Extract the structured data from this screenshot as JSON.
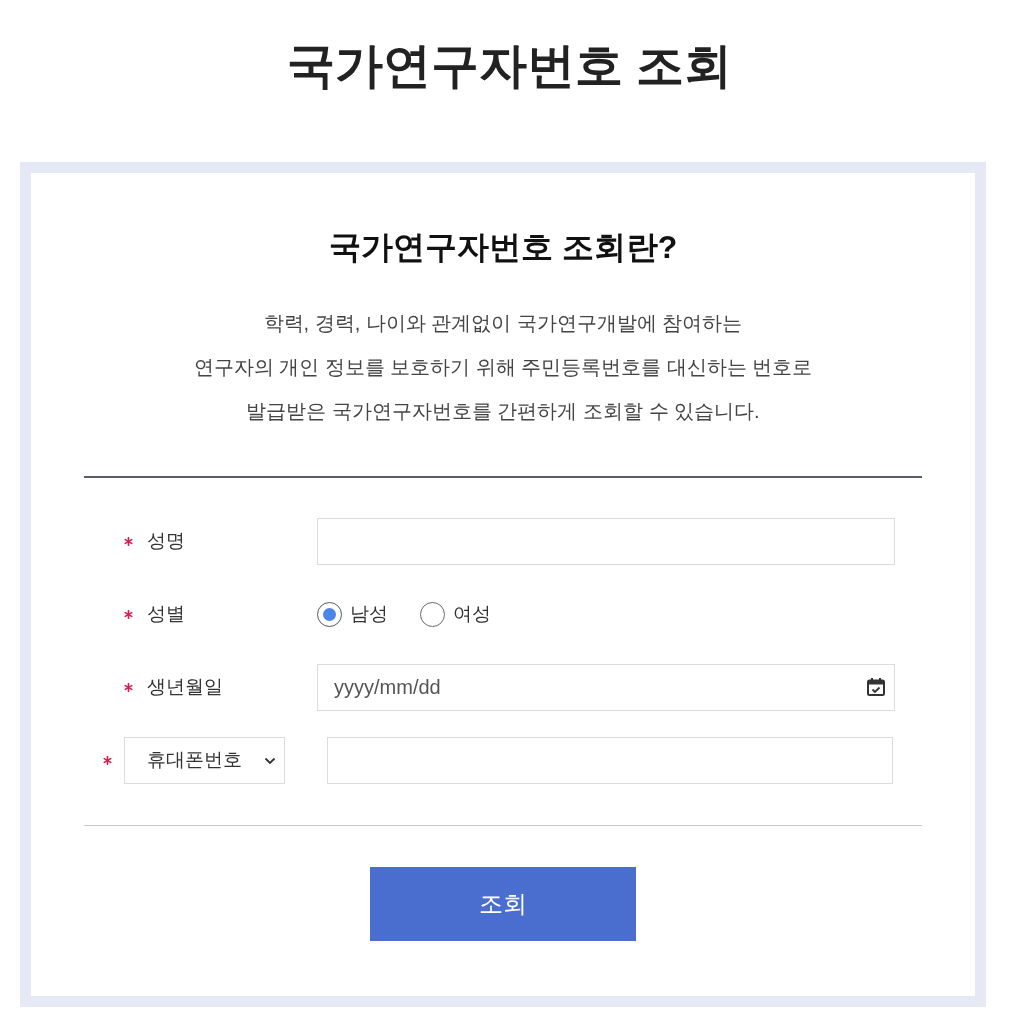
{
  "page": {
    "title": "국가연구자번호 조회"
  },
  "info": {
    "heading": "국가연구자번호 조회란?",
    "lines": [
      "학력, 경력, 나이와 관계없이 국가연구개발에 참여하는",
      "연구자의 개인 정보를 보호하기 위해 주민등록번호를 대신하는 번호로",
      "발급받은 국가연구자번호를 간편하게 조회할 수 있습니다."
    ]
  },
  "form": {
    "fields": [
      {
        "kind": "text",
        "label": "성명",
        "required": true
      },
      {
        "kind": "radio",
        "label": "성별",
        "required": true,
        "options": [
          {
            "label": "남성",
            "selected": true
          },
          {
            "label": "여성",
            "selected": false
          }
        ]
      },
      {
        "kind": "date",
        "label": "생년월일",
        "required": true,
        "placeholder": "yyyy/mm/dd"
      },
      {
        "kind": "select",
        "required": true,
        "value": "휴대폰번호"
      }
    ]
  },
  "submit": {
    "label": "조회"
  }
}
